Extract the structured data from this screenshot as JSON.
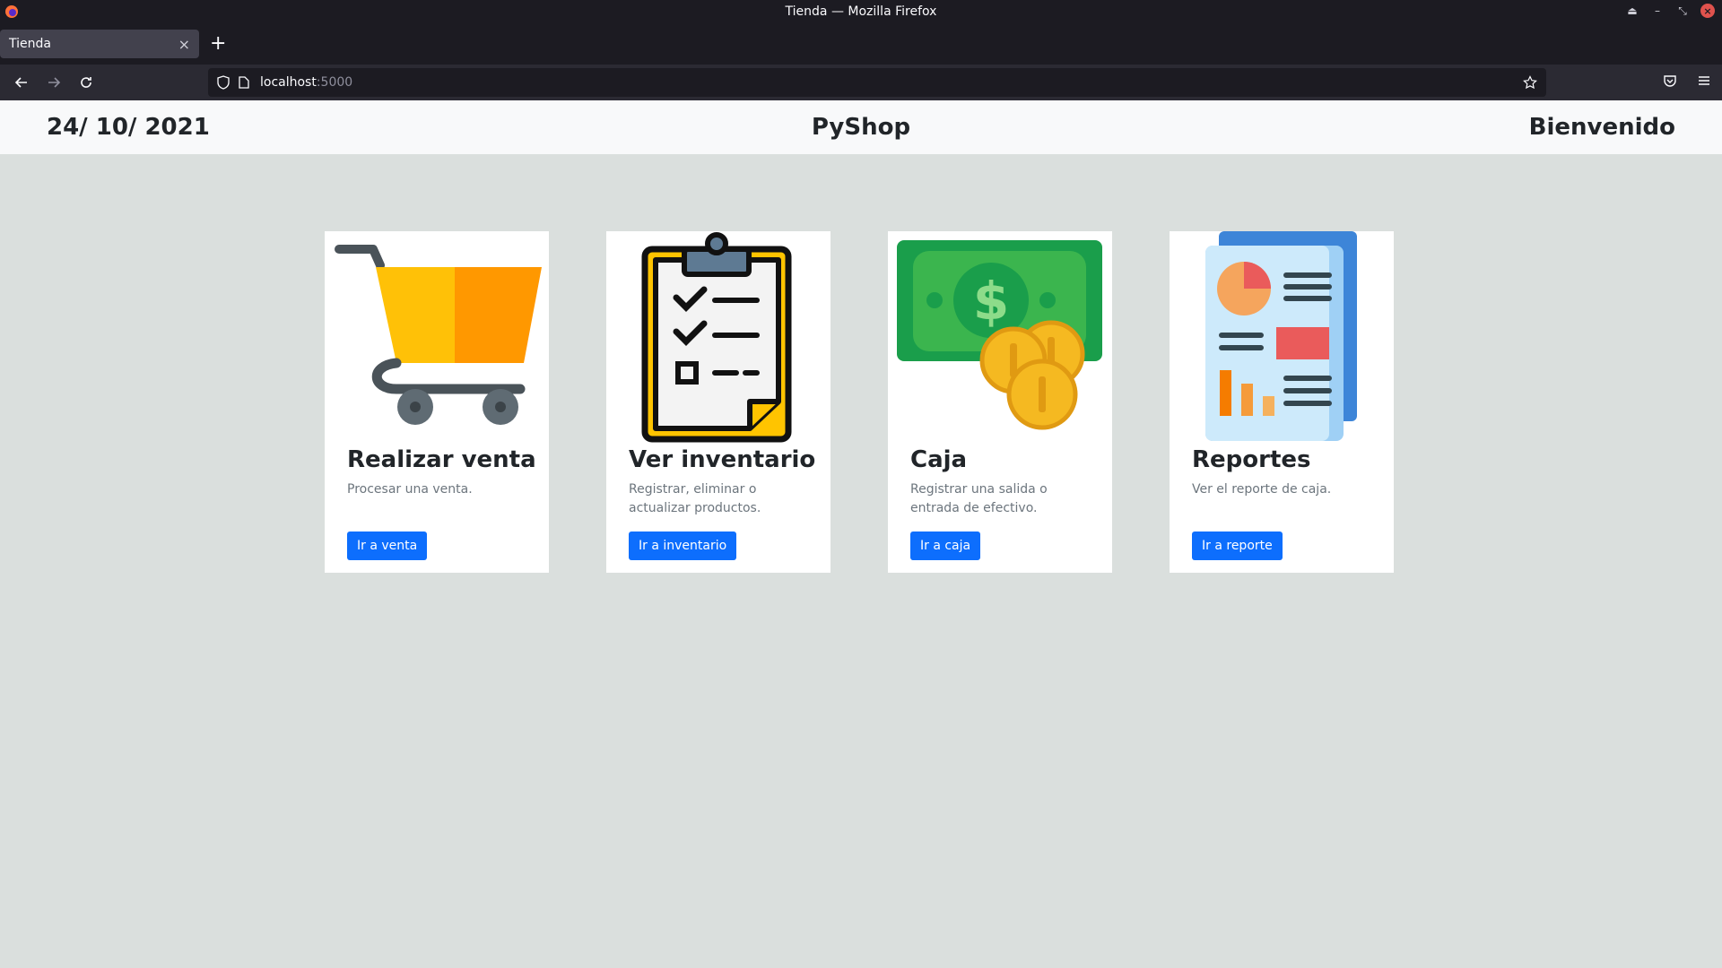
{
  "window": {
    "title": "Tienda — Mozilla Firefox"
  },
  "tab": {
    "title": "Tienda"
  },
  "urlbar": {
    "host": "localhost",
    "port": ":5000"
  },
  "header": {
    "date": "24/ 10/ 2021",
    "brand": "PyShop",
    "welcome": "Bienvenido"
  },
  "cards": [
    {
      "title": "Realizar venta",
      "text": "Procesar una venta.",
      "button": "Ir a venta",
      "icon": "shopping-cart-icon"
    },
    {
      "title": "Ver inventario",
      "text": "Registrar, eliminar o actualizar productos.",
      "button": "Ir a inventario",
      "icon": "clipboard-checklist-icon"
    },
    {
      "title": "Caja",
      "text": "Registrar una salida o entrada de efectivo.",
      "button": "Ir a caja",
      "icon": "money-coins-icon"
    },
    {
      "title": "Reportes",
      "text": "Ver el reporte de caja.",
      "button": "Ir a reporte",
      "icon": "report-document-icon"
    }
  ],
  "colors": {
    "primary": "#0d6efd",
    "page_bg": "#dadfdd",
    "header_bg": "#f8f9fa"
  }
}
